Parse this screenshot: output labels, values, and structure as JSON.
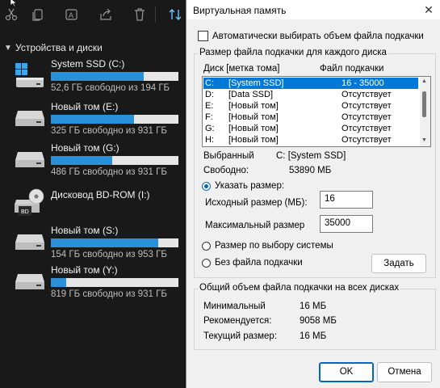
{
  "explorer": {
    "section_label": "Устройства и диски",
    "toolbar_icons": [
      "cut-icon",
      "copy-icon",
      "rename-icon",
      "share-icon",
      "delete-icon",
      "sort-icon"
    ],
    "drives": [
      {
        "name": "System SSD (C:)",
        "free_text": "52,6 ГБ свободно из 194 ГБ",
        "used_fraction": 0.73,
        "icon": "windows-drive-icon"
      },
      {
        "name": "Новый том (E:)",
        "free_text": "325 ГБ свободно из 931 ГБ",
        "used_fraction": 0.65,
        "icon": "hard-drive-icon"
      },
      {
        "name": "Новый том (G:)",
        "free_text": "486 ГБ свободно из 931 ГБ",
        "used_fraction": 0.48,
        "icon": "hard-drive-icon"
      },
      {
        "name": "Дисковод BD-ROM (I:)",
        "free_text": "",
        "used_fraction": null,
        "icon": "bd-rom-icon",
        "icon_label": "BD"
      },
      {
        "name": "Новый том (S:)",
        "free_text": "154 ГБ свободно из 953 ГБ",
        "used_fraction": 0.84,
        "icon": "hard-drive-icon"
      },
      {
        "name": "Новый том (Y:)",
        "free_text": "819 ГБ свободно из 931 ГБ",
        "used_fraction": 0.12,
        "icon": "hard-drive-icon"
      }
    ],
    "colors": {
      "bar_fill": "#2a90d8",
      "bar_track": "#e6e6e6",
      "background": "#191919"
    }
  },
  "dialog": {
    "title": "Виртуальная память",
    "auto_manage_label": "Автоматически выбирать объем файла подкачки",
    "auto_manage_checked": false,
    "per_drive_group_label": "Размер файла подкачки для каждого диска",
    "columns": {
      "drive": "Диск [метка тома]",
      "paging": "Файл подкачки"
    },
    "drives": [
      {
        "letter": "C:",
        "label": "[System SSD]",
        "paging": "16 - 35000",
        "selected": true
      },
      {
        "letter": "D:",
        "label": "[Data SSD]",
        "paging": "Отсутствует",
        "selected": false
      },
      {
        "letter": "E:",
        "label": "[Новый том]",
        "paging": "Отсутствует",
        "selected": false
      },
      {
        "letter": "F:",
        "label": "[Новый том]",
        "paging": "Отсутствует",
        "selected": false
      },
      {
        "letter": "G:",
        "label": "[Новый том]",
        "paging": "Отсутствует",
        "selected": false
      },
      {
        "letter": "H:",
        "label": "[Новый том]",
        "paging": "Отсутствует",
        "selected": false
      }
    ],
    "selected_label": "Выбранный",
    "selected_value": "C:  [System SSD]",
    "free_label": "Свободно:",
    "free_value": "53890 МБ",
    "custom_size_label": "Указать размер:",
    "initial_label": "Исходный размер (МБ):",
    "initial_value": "16",
    "max_label": "Максимальный размер",
    "max_value": "35000",
    "system_managed_label": "Размер по выбору системы",
    "no_paging_label": "Без файла подкачки",
    "set_button": "Задать",
    "total_group_label": "Общий объем файла подкачки на всех дисках",
    "min_label": "Минимальный",
    "min_value": "16 МБ",
    "recommended_label": "Рекомендуется:",
    "recommended_value": "9058 МБ",
    "current_label": "Текущий размер:",
    "current_value": "16 МБ",
    "ok_button": "OK",
    "cancel_button": "Отмена",
    "close_icon": "close-icon",
    "accent_color": "#0067c0",
    "selection_color": "#0078d7"
  }
}
